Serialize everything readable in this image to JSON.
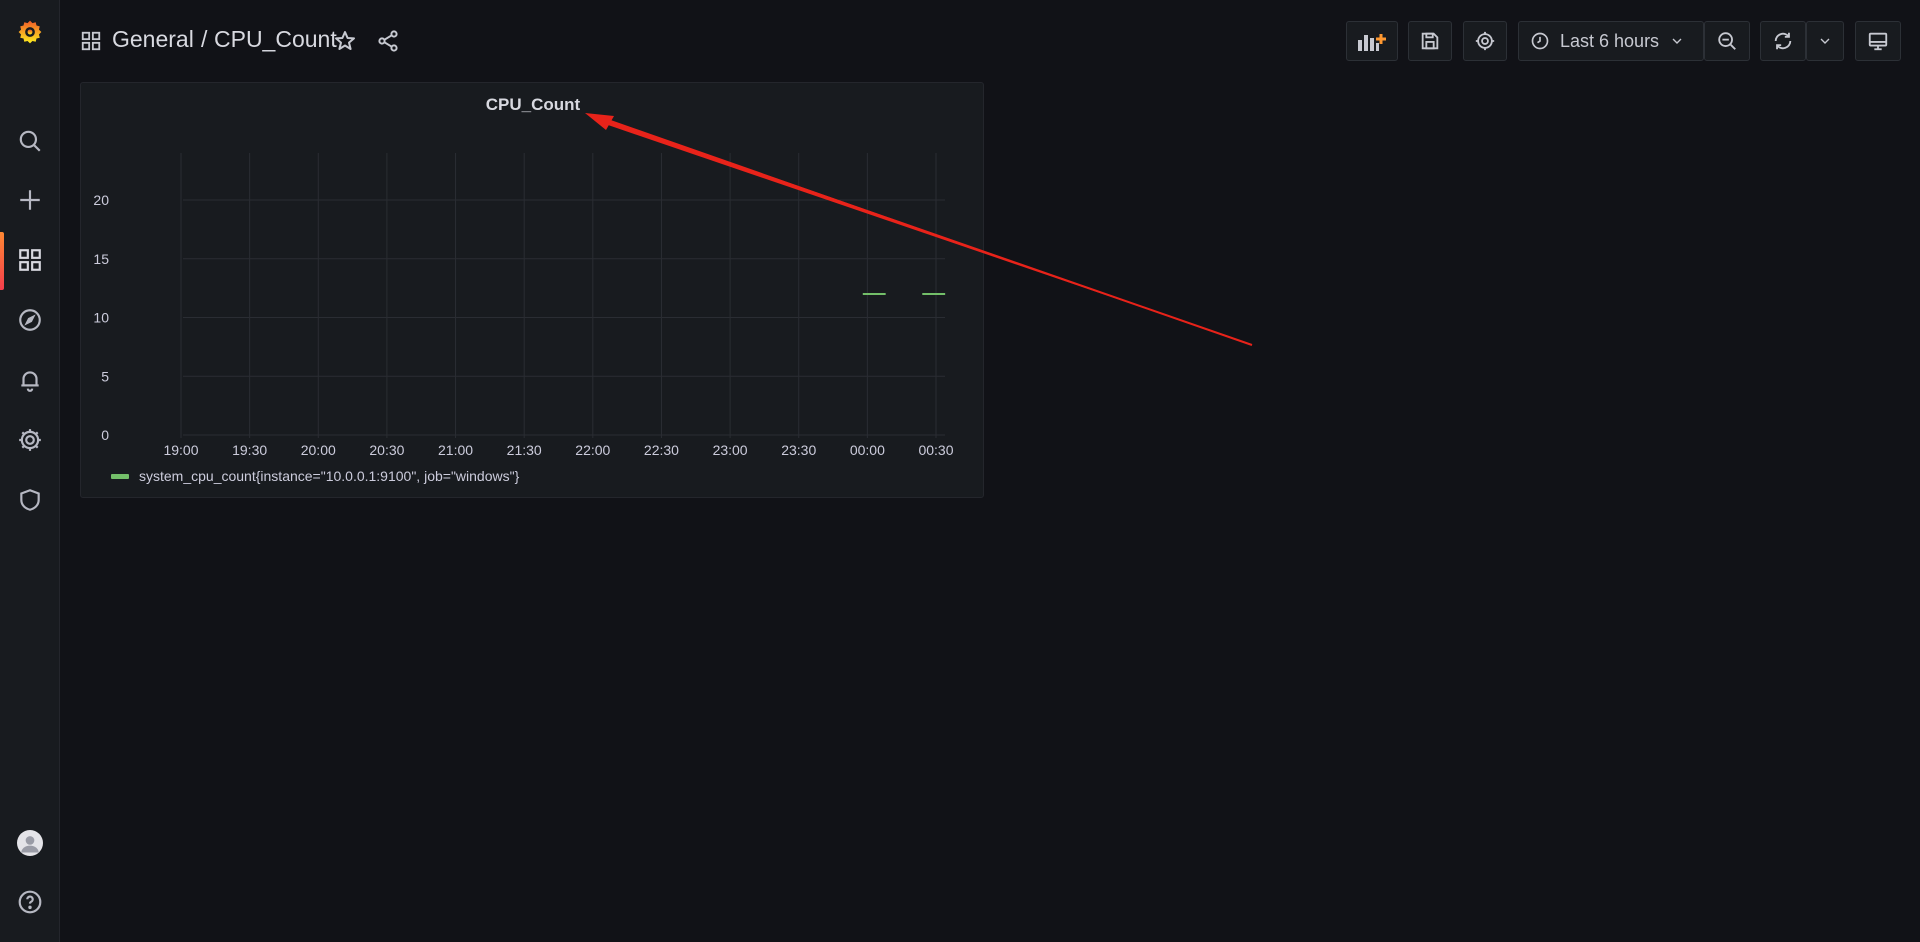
{
  "breadcrumb": {
    "folder": "General",
    "separator": "/",
    "dashboard": "CPU_Count"
  },
  "time_picker": {
    "label": "Last 6 hours"
  },
  "colors": {
    "accent": "#ff8833",
    "series": "#73bf69",
    "annotation_arrow": "#e8231a"
  },
  "sidebar": {
    "items": [
      {
        "name": "search-icon"
      },
      {
        "name": "plus-icon"
      },
      {
        "name": "dashboards-icon",
        "active": true
      },
      {
        "name": "explore-compass-icon"
      },
      {
        "name": "alerting-bell-icon"
      },
      {
        "name": "configuration-gear-icon"
      },
      {
        "name": "server-admin-shield-icon"
      }
    ],
    "bottom": [
      {
        "name": "user-avatar"
      },
      {
        "name": "help-icon"
      }
    ]
  },
  "panel": {
    "title": "CPU_Count",
    "legend": "system_cpu_count{instance=\"10.0.0.1:9100\", job=\"windows\"}"
  },
  "chart_data": {
    "type": "line",
    "title": "CPU_Count",
    "xlabel": "",
    "ylabel": "",
    "x_ticks": [
      "19:00",
      "19:30",
      "20:00",
      "20:30",
      "21:00",
      "21:30",
      "22:00",
      "22:30",
      "23:00",
      "23:30",
      "00:00",
      "00:30"
    ],
    "y_ticks": [
      0,
      5,
      10,
      15,
      20
    ],
    "ylim": [
      0,
      24
    ],
    "grid": true,
    "legend_placement": "bottom-left",
    "series": [
      {
        "name": "system_cpu_count{instance=\"10.0.0.1:9100\", job=\"windows\"}",
        "segments": [
          {
            "x": [
              "23:58",
              "00:08"
            ],
            "y": [
              12,
              12
            ]
          },
          {
            "x": [
              "00:24",
              "00:34"
            ],
            "y": [
              12,
              12
            ]
          }
        ]
      }
    ]
  }
}
